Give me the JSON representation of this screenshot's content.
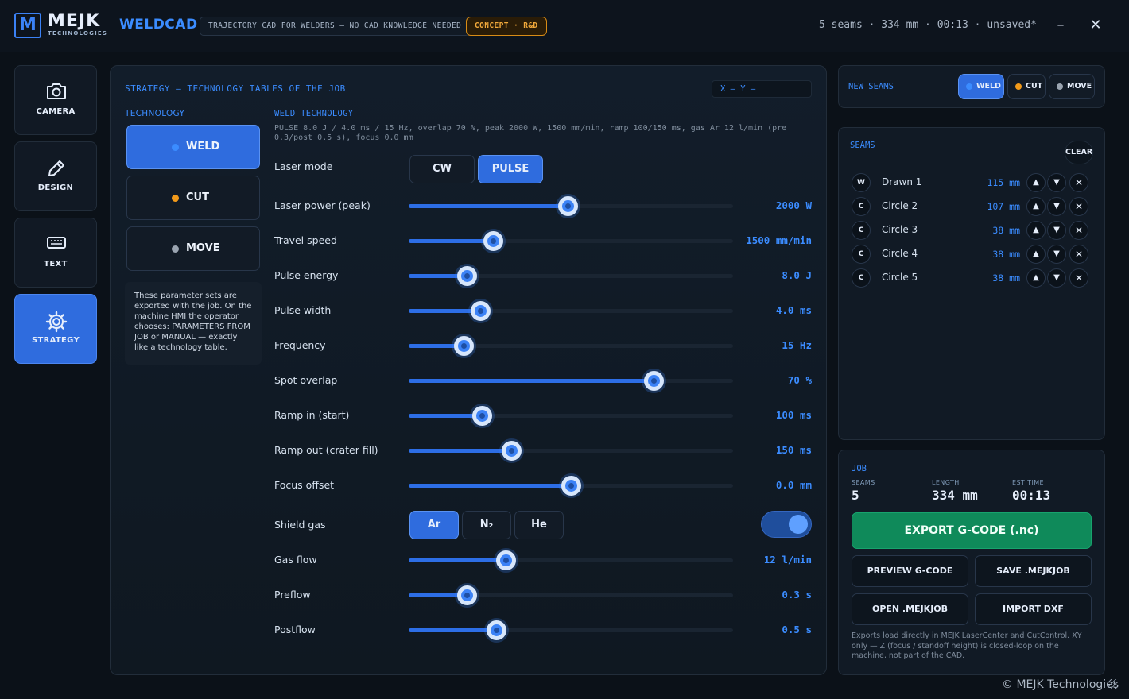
{
  "header": {
    "logo_mark": "M",
    "logo_name": "MEJK",
    "logo_sub": "TECHNOLOGIES",
    "app_name": "WELDCAD",
    "tagline": "TRAJECTORY CAD FOR WELDERS — NO CAD KNOWLEDGE NEEDED",
    "concept_badge": "CONCEPT · R&D",
    "status": "5 seams · 334 mm · 00:13 · unsaved*",
    "minimize": "–",
    "close": "✕"
  },
  "sidebar": {
    "items": [
      {
        "label": "CAMERA",
        "icon": "camera-icon"
      },
      {
        "label": "DESIGN",
        "icon": "pencil-icon"
      },
      {
        "label": "TEXT",
        "icon": "keyboard-icon"
      },
      {
        "label": "STRATEGY",
        "icon": "gear-icon",
        "active": true
      }
    ]
  },
  "strategy": {
    "title": "STRATEGY — TECHNOLOGY TABLES OF THE JOB",
    "coords": "X –   Y –",
    "technology_label": "TECHNOLOGY",
    "technologies": [
      {
        "label": "WELD",
        "dot_color": "#3b8cff",
        "active": true
      },
      {
        "label": "CUT",
        "dot_color": "#f29a1a",
        "active": false
      },
      {
        "label": "MOVE",
        "dot_color": "#9aa4b0",
        "active": false
      }
    ],
    "note": "These parameter sets are exported with the job. On the machine HMI the operator chooses: PARAMETERS FROM JOB or MANUAL — exactly like a technology table.",
    "weld_label": "WELD TECHNOLOGY",
    "weld_summary": "PULSE 8.0 J / 4.0 ms / 15 Hz, overlap 70 %, peak 2000 W, 1500 mm/min, ramp 100/150 ms, gas Ar 12 l/min (pre 0.3/post 0.5 s), focus 0.0 mm",
    "laser_mode": {
      "label": "Laser mode",
      "options": [
        "CW",
        "PULSE"
      ],
      "selected": "PULSE"
    },
    "params": [
      {
        "label": "Laser power (peak)",
        "value": "2000 W",
        "level": 0.49
      },
      {
        "label": "Travel speed",
        "value": "1500 mm/min",
        "level": 0.26
      },
      {
        "label": "Pulse energy",
        "value": "8.0 J",
        "level": 0.18
      },
      {
        "label": "Pulse width",
        "value": "4.0 ms",
        "level": 0.22
      },
      {
        "label": "Frequency",
        "value": "15 Hz",
        "level": 0.17
      },
      {
        "label": "Spot overlap",
        "value": "70 %",
        "level": 0.755
      },
      {
        "label": "Ramp in (start)",
        "value": "100 ms",
        "level": 0.225
      },
      {
        "label": "Ramp out (crater fill)",
        "value": "150 ms",
        "level": 0.315
      },
      {
        "label": "Focus offset",
        "value": "0.0 mm",
        "level": 0.5
      }
    ],
    "shield_gas": {
      "label": "Shield gas",
      "options": [
        "Ar",
        "N₂",
        "He"
      ],
      "selected": "Ar",
      "enabled": true
    },
    "gas_params": [
      {
        "label": "Gas flow",
        "value": "12 l/min",
        "level": 0.3
      },
      {
        "label": "Preflow",
        "value": "0.3 s",
        "level": 0.18
      },
      {
        "label": "Postflow",
        "value": "0.5 s",
        "level": 0.27
      }
    ]
  },
  "new_seams": {
    "label": "NEW SEAMS",
    "options": [
      {
        "label": "WELD",
        "dot_color": "#3b8cff",
        "active": true
      },
      {
        "label": "CUT",
        "dot_color": "#f29a1a",
        "active": false
      },
      {
        "label": "MOVE",
        "dot_color": "#9aa4b0",
        "active": false
      }
    ]
  },
  "seams": {
    "label": "SEAMS",
    "clear": "CLEAR",
    "items": [
      {
        "type": "W",
        "name": "Drawn 1",
        "length": "115 mm"
      },
      {
        "type": "C",
        "name": "Circle 2",
        "length": "107 mm"
      },
      {
        "type": "C",
        "name": "Circle 3",
        "length": "38 mm"
      },
      {
        "type": "C",
        "name": "Circle 4",
        "length": "38 mm"
      },
      {
        "type": "C",
        "name": "Circle 5",
        "length": "38 mm"
      }
    ],
    "up": "▲",
    "down": "▼",
    "remove": "✕"
  },
  "job": {
    "label": "JOB",
    "stats": [
      {
        "label": "SEAMS",
        "value": "5"
      },
      {
        "label": "LENGTH",
        "value": "334 mm"
      },
      {
        "label": "EST TIME",
        "value": "00:13"
      }
    ],
    "export": "EXPORT G-CODE (.nc)",
    "preview": "PREVIEW G-CODE",
    "save": "SAVE .MEJKJOB",
    "open": "OPEN .MEJKJOB",
    "import": "IMPORT DXF",
    "note": "Exports load directly in MEJK LaserCenter and CutControl. XY only — Z (focus / standoff height) is closed-loop on the machine, not part of the CAD."
  },
  "footer": {
    "copyright": "© MEJK Technologies"
  },
  "colors": {
    "accent": "#3b8cff",
    "active_bg": "#2f6cde",
    "export_green": "#0f8a5a",
    "concept_orange": "#f2a93b"
  }
}
